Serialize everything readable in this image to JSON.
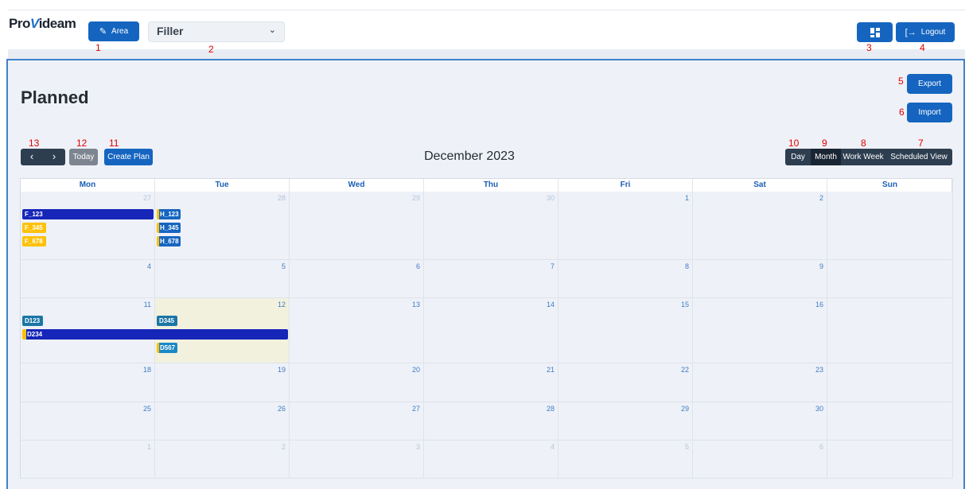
{
  "header": {
    "logo": {
      "part1": "Pro",
      "part2": "V",
      "part3": "ideam"
    },
    "area_label": "Area",
    "area_icon": "edit-icon",
    "filler_value": "Filler",
    "dashboard_icon": "dashboard-icon",
    "logout_label": "Logout",
    "logout_icon": "logout-icon"
  },
  "markers": {
    "m1": "1",
    "m2": "2",
    "m3": "3",
    "m4": "4",
    "m5": "5",
    "m6": "6",
    "m7": "7",
    "m8": "8",
    "m9": "9",
    "m10": "10",
    "m11": "11",
    "m12": "12",
    "m13": "13"
  },
  "page": {
    "title": "Planned",
    "export_label": "Export",
    "import_label": "Import"
  },
  "toolbar": {
    "prev": "‹",
    "next": "›",
    "today_label": "Today",
    "create_plan_label": "Create Plan",
    "calendar_title": "December 2023",
    "views": {
      "day": "Day",
      "month": "Month",
      "work_week": "Work Week",
      "scheduled": "Scheduled View"
    },
    "active_view": "Month"
  },
  "calendar": {
    "weekdays": [
      "Mon",
      "Tue",
      "Wed",
      "Thu",
      "Fri",
      "Sat",
      "Sun"
    ],
    "weeks": [
      [
        "27",
        "28",
        "29",
        "30",
        "1",
        "2",
        ""
      ],
      [
        "4",
        "5",
        "6",
        "7",
        "8",
        "9",
        ""
      ],
      [
        "11",
        "12",
        "13",
        "14",
        "15",
        "16",
        ""
      ],
      [
        "18",
        "19",
        "20",
        "21",
        "22",
        "23",
        ""
      ],
      [
        "25",
        "26",
        "27",
        "28",
        "29",
        "30",
        ""
      ],
      [
        "1",
        "2",
        "3",
        "4",
        "5",
        "6",
        ""
      ]
    ],
    "today": "12",
    "events": [
      {
        "label": "F_123",
        "week": 0,
        "day": 0,
        "span": 1,
        "row": 0,
        "style": "navy"
      },
      {
        "label": "F_345",
        "week": 0,
        "day": 0,
        "span": 1,
        "row": 1,
        "style": "yellow"
      },
      {
        "label": "F_678",
        "week": 0,
        "day": 0,
        "span": 1,
        "row": 2,
        "style": "yellow"
      },
      {
        "label": "H_123",
        "week": 0,
        "day": 1,
        "span": 1,
        "row": 0,
        "style": "blue"
      },
      {
        "label": "H_345",
        "week": 0,
        "day": 1,
        "span": 1,
        "row": 1,
        "style": "blue"
      },
      {
        "label": "H_678",
        "week": 0,
        "day": 1,
        "span": 1,
        "row": 2,
        "style": "blue"
      },
      {
        "label": "D123",
        "week": 2,
        "day": 0,
        "span": 1,
        "row": 0,
        "style": "teal"
      },
      {
        "label": "D345",
        "week": 2,
        "day": 1,
        "span": 1,
        "row": 0,
        "style": "teal"
      },
      {
        "label": "D234",
        "week": 2,
        "day": 0,
        "span": 2,
        "row": 1,
        "style": "navy-y"
      },
      {
        "label": "D567",
        "week": 2,
        "day": 1,
        "span": 1,
        "row": 2,
        "style": "teal-y"
      }
    ]
  },
  "colors": {
    "primary": "#1565c0",
    "accent_border": "#3f82c8",
    "event_navy": "#1626b9",
    "event_yellow": "#ffc107",
    "today_bg": "#f2f1de"
  }
}
